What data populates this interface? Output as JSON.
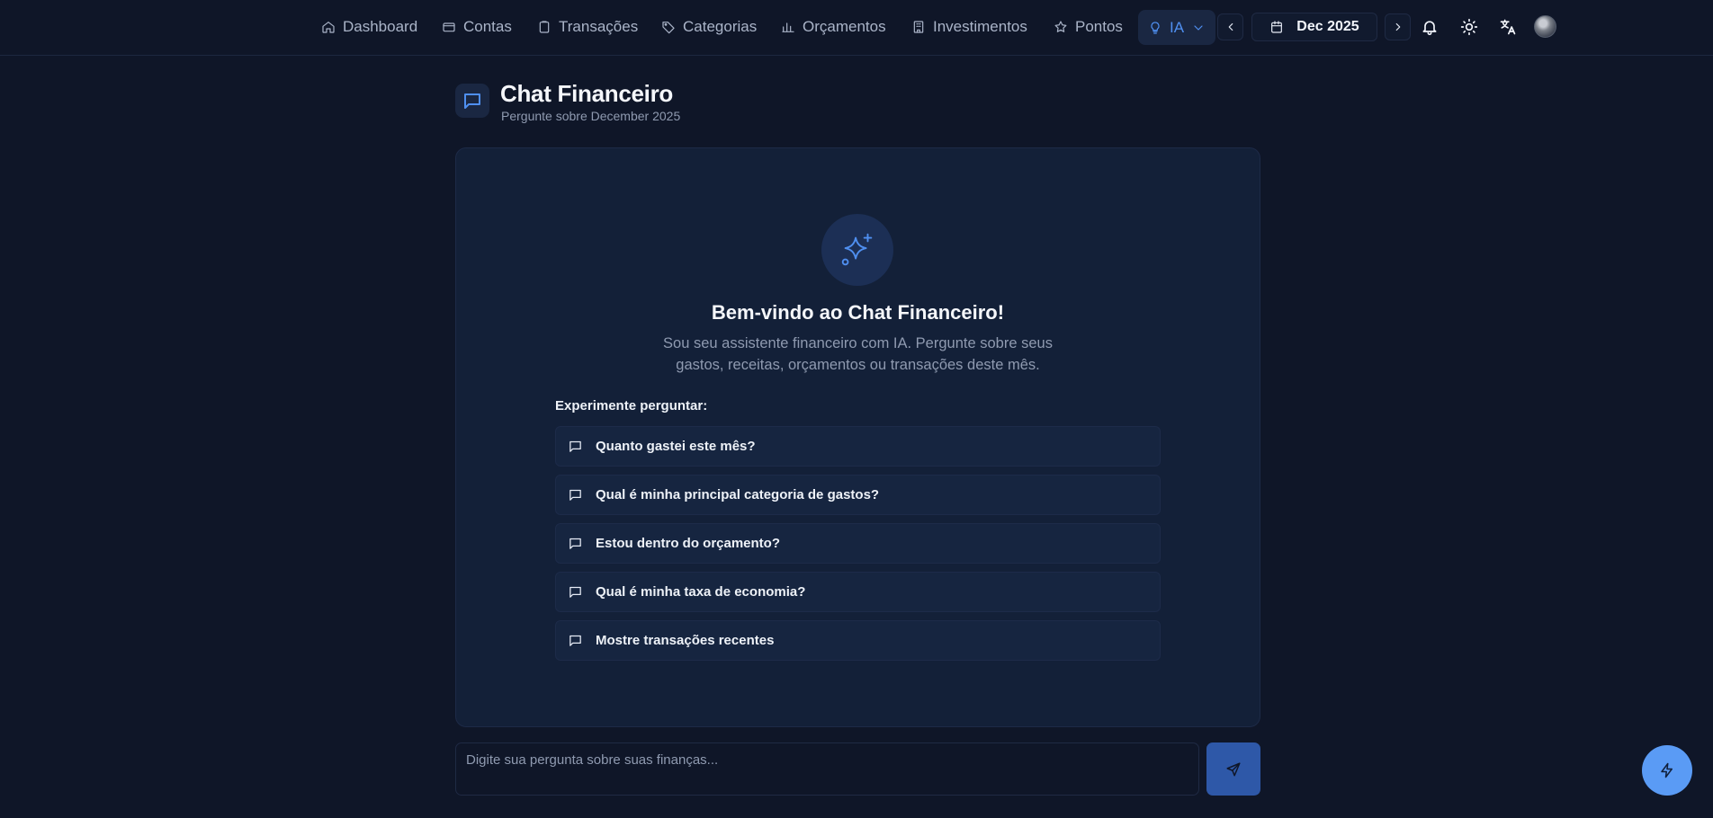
{
  "nav": {
    "items": [
      {
        "label": "Dashboard",
        "icon": "home-icon"
      },
      {
        "label": "Contas",
        "icon": "wallet-icon"
      },
      {
        "label": "Transações",
        "icon": "clipboard-icon"
      },
      {
        "label": "Categorias",
        "icon": "tag-icon"
      },
      {
        "label": "Orçamentos",
        "icon": "bar-chart-icon"
      },
      {
        "label": "Investimentos",
        "icon": "building-icon"
      },
      {
        "label": "Pontos",
        "icon": "star-icon"
      }
    ],
    "ia": {
      "label": "IA",
      "icon": "lightbulb-icon"
    },
    "date": "Dec 2025"
  },
  "header": {
    "title": "Chat Financeiro",
    "subtitle": "Pergunte sobre December 2025"
  },
  "welcome": {
    "title": "Bem-vindo ao Chat Financeiro!",
    "text": "Sou seu assistente financeiro com IA. Pergunte sobre seus gastos, receitas, orçamentos ou transações deste mês.",
    "try_label": "Experimente perguntar:"
  },
  "suggestions": [
    "Quanto gastei este mês?",
    "Qual é minha principal categoria de gastos?",
    "Estou dentro do orçamento?",
    "Qual é minha taxa de economia?",
    "Mostre transações recentes"
  ],
  "input": {
    "placeholder": "Digite sua pergunta sobre suas finanças..."
  },
  "colors": {
    "background": "#0f1628",
    "card": "#132038",
    "accent": "#4f8ff0",
    "fab": "#5a9bf5"
  }
}
